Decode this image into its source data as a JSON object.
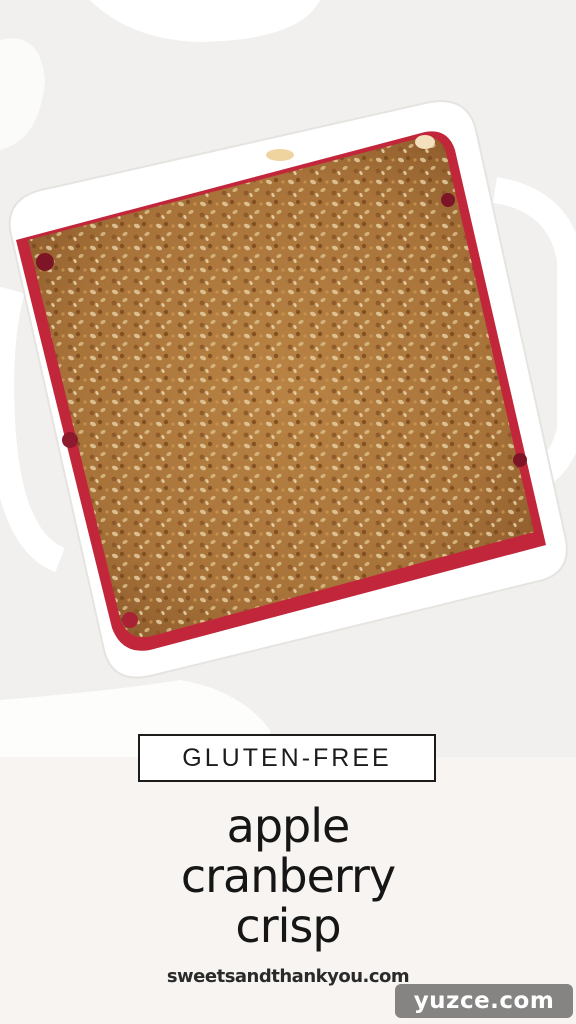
{
  "photo": {
    "subject": "apple cranberry crisp in a square white baking dish",
    "colors": {
      "background": "#f1f0ee",
      "dish": "#ffffff",
      "crumble": "#b07a3e",
      "cranberry": "#c2263a"
    }
  },
  "badge": {
    "label": "GLUTEN-FREE"
  },
  "title": {
    "line1": "apple",
    "line2": "cranberry",
    "line3": "crisp"
  },
  "website": "sweetsandthankyou.com",
  "watermark": "yuzce.com"
}
